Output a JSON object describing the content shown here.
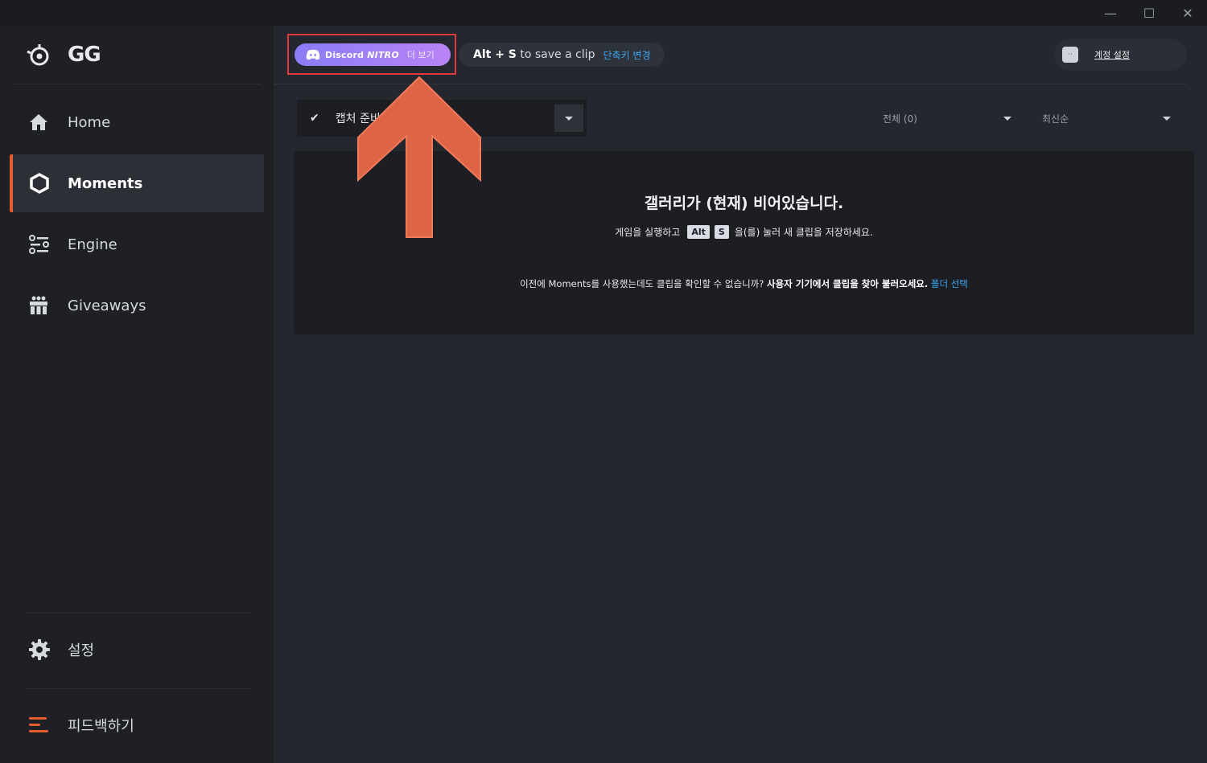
{
  "app": {
    "logo_text": "GG"
  },
  "window_controls": {
    "minimize": "—",
    "maximize": "☐",
    "close": "✕"
  },
  "sidebar": {
    "items": [
      {
        "label": "Home",
        "icon": "home-icon"
      },
      {
        "label": "Moments",
        "icon": "moments-hex-icon",
        "active": true
      },
      {
        "label": "Engine",
        "icon": "engine-sliders-icon"
      },
      {
        "label": "Giveaways",
        "icon": "gift-icon"
      }
    ],
    "settings_label": "설정",
    "feedback_label": "피드백하기"
  },
  "header": {
    "nitro": {
      "brand": "Discord",
      "tier": "NITRO",
      "more": "더 보기"
    },
    "hint": {
      "keys": "Alt + S",
      "text": " to save a clip",
      "link": "단축키 변경"
    },
    "account_label": "계정 설정"
  },
  "filters": {
    "status_label": "캡처 준비",
    "all_label": "전체 (0)",
    "sort_label": "최신순"
  },
  "empty_state": {
    "title": "갤러리가 (현재) 비어있습니다.",
    "sub_before": "게임을 실행하고",
    "key1": "Alt",
    "key2": "S",
    "sub_after": "을(를) 눌러 새 클립을 저장하세요.",
    "note_plain": "이전에 Moments를 사용했는데도 클립을 확인할 수 없습니까?",
    "note_bold": "사용자 기기에서 클립을 찾아 불러오세요.",
    "note_link": "폴더 선택"
  },
  "colors": {
    "accent": "#e85b2a",
    "link": "#3ea6f2",
    "arrow": "#dd6444",
    "highlight_box": "#e03a3e"
  }
}
